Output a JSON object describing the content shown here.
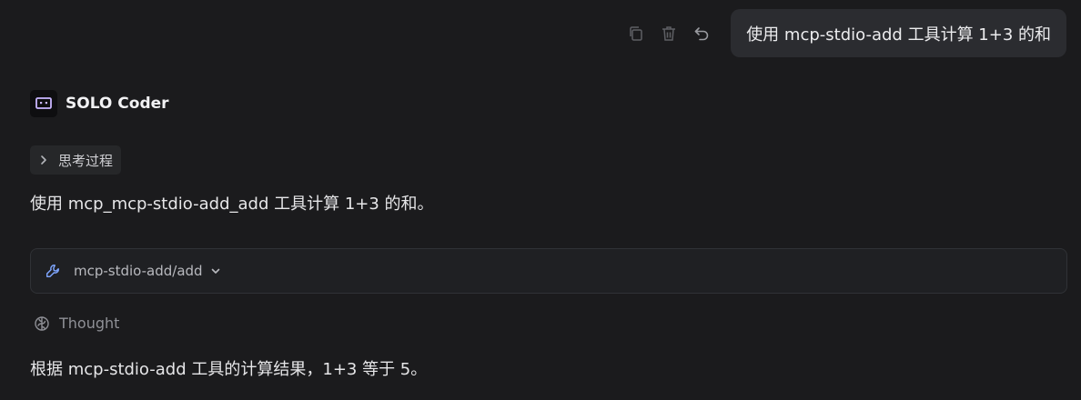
{
  "user_message": {
    "text": "使用 mcp-stdio-add 工具计算 1+3 的和",
    "actions": [
      "copy-icon",
      "trash-icon",
      "undo-icon"
    ]
  },
  "agent": {
    "name": "SOLO Coder",
    "avatar_icon": "bot-icon"
  },
  "thinking_toggle": {
    "label": "思考过程"
  },
  "response": {
    "intro": "使用 mcp_mcp-stdio-add_add 工具计算 1+3 的和。",
    "tool_call": {
      "name": "mcp-stdio-add/add",
      "icon": "wrench-icon"
    },
    "thought_label": "Thought",
    "result": "根据 mcp-stdio-add 工具的计算结果，1+3 等于 5。"
  },
  "colors": {
    "background": "#1b1b1d",
    "bubble": "#2b2c30",
    "accent_icon": "#7fa6ff"
  }
}
